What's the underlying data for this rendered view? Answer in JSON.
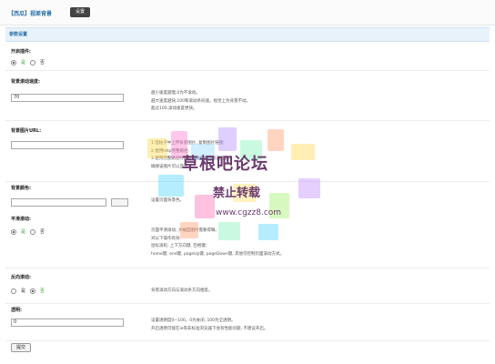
{
  "header": {
    "title": "【西瓜】视差背景",
    "settings_button": "设置"
  },
  "section": {
    "title": "参数设置"
  },
  "enable": {
    "label": "开启插件:",
    "yes": "是",
    "no": "否",
    "selected": "yes"
  },
  "scroll_speed": {
    "label": "背景滚动速度:",
    "value": "70",
    "desc": [
      "越小速度越慢,0为不滚动。",
      "越大速度越快,100和滚动条同速。视觉上为背景不动。",
      "超过100,滚动速度更快。"
    ]
  },
  "image_url": {
    "label": "背景图片URL:",
    "value": "",
    "desc": [
      "1.但帖子中上传背景图片, 复制图片链接;",
      "2.使用http完整路径;",
      "3.使用完整路径时请复制粘贴到浏览器检验;",
      "确保该图片可以显示。"
    ]
  },
  "bg_color": {
    "label": "背景颜色:",
    "value": "",
    "desc": [
      "设置页面背景色。"
    ]
  },
  "smooth_scroll": {
    "label": "平滑滚动:",
    "yes": "是",
    "no": "否",
    "selected": "yes",
    "desc": [
      "页面平滑滚动, 大幅度图片需要得嘛。",
      "对以下操作有效:",
      "鼠标滚轮, 上下方向键, 空格键;",
      "home键, end键, pageUp键, pageDown键, 其他可控制页面滚动方式。"
    ]
  },
  "reverse": {
    "label": "反向滚动:",
    "yes": "是",
    "no": "否",
    "selected": "no",
    "desc": [
      "背景滚动方向与滚动条方向相反。"
    ]
  },
  "opacity": {
    "label": "透明:",
    "value": "0",
    "desc": [
      "设置透明度0~100。0为关闭, 100为全透明。",
      "开启透明可能在ie等非标准浏览器下会有性能问题, 不建议开启。"
    ]
  },
  "submit_label": "提交",
  "watermark": {
    "title": "草根吧论坛",
    "subtitle": "禁止转载",
    "url": "www.cgzz8.com"
  },
  "colors": {
    "link_blue": "#2a6fa8",
    "green": "#3aa63a",
    "watermark": "#6b3b6d"
  }
}
